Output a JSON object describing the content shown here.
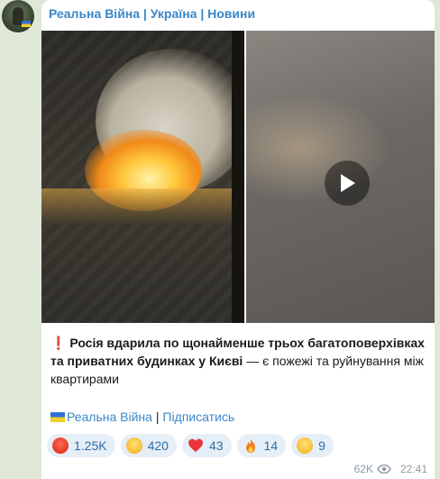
{
  "post": {
    "channel_name": "Реальна Війна | Україна | Новини",
    "alarm_emoji": "❗",
    "headline_bold": "Росія вдарила по щонайменше трьох багатоповерхівках та приватних будинках у Києві",
    "headline_rest": " — є пожежі та руйнування між квартирами",
    "footer_link": "Реальна Війна",
    "footer_separator": " | ",
    "footer_subscribe": "Підписатись",
    "views": "62K",
    "time": "22:41"
  },
  "reactions": [
    {
      "icon": "angry-face-icon",
      "count": "1.25K"
    },
    {
      "icon": "crying-face-icon",
      "count": "420"
    },
    {
      "icon": "heart-icon",
      "count": "43"
    },
    {
      "icon": "fire-icon",
      "count": "14"
    },
    {
      "icon": "grinning-face-icon",
      "count": "9"
    }
  ],
  "colors": {
    "link": "#3a86c8",
    "chat_background": "#dfe7d7",
    "reaction_bg": "#e6eef7",
    "alarm": "#e53935"
  }
}
